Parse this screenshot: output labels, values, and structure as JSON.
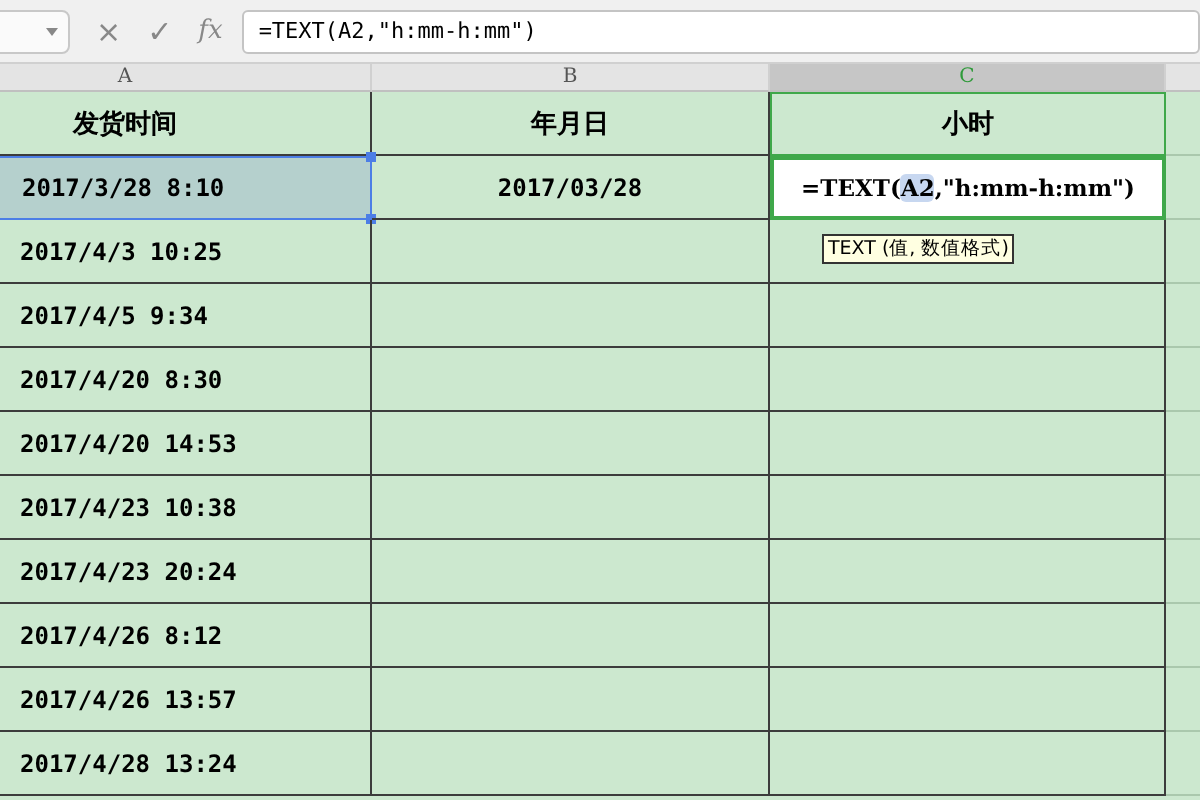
{
  "formula_bar": {
    "cancel": "×",
    "confirm": "✓",
    "fx": "fx",
    "formula": "=TEXT(A2,\"h:mm-h:mm\")"
  },
  "columns": [
    {
      "label": "A",
      "selected": false
    },
    {
      "label": "B",
      "selected": false
    },
    {
      "label": "C",
      "selected": true
    }
  ],
  "header_row": [
    "发货时间",
    "年月日",
    "小时"
  ],
  "rows": [
    {
      "time": "2017/3/28 8:10",
      "date": "2017/03/28",
      "referenced": true
    },
    {
      "time": "2017/4/3 10:25",
      "referenced": false
    },
    {
      "time": "2017/4/5 9:34",
      "referenced": false
    },
    {
      "time": "2017/4/20 8:30",
      "referenced": false
    },
    {
      "time": "2017/4/20 14:53",
      "referenced": false
    },
    {
      "time": "2017/4/23 10:38",
      "referenced": false
    },
    {
      "time": "2017/4/23 20:24",
      "referenced": false
    },
    {
      "time": "2017/4/26 8:12",
      "referenced": false
    },
    {
      "time": "2017/4/26 13:57",
      "referenced": false
    },
    {
      "time": "2017/4/28 13:24",
      "referenced": false
    }
  ],
  "editing_cell": {
    "before": "=TEXT(",
    "ref": "A2",
    "after": ",\"h:mm-h:mm\")"
  },
  "tooltip": "TEXT (值, 数值格式)"
}
